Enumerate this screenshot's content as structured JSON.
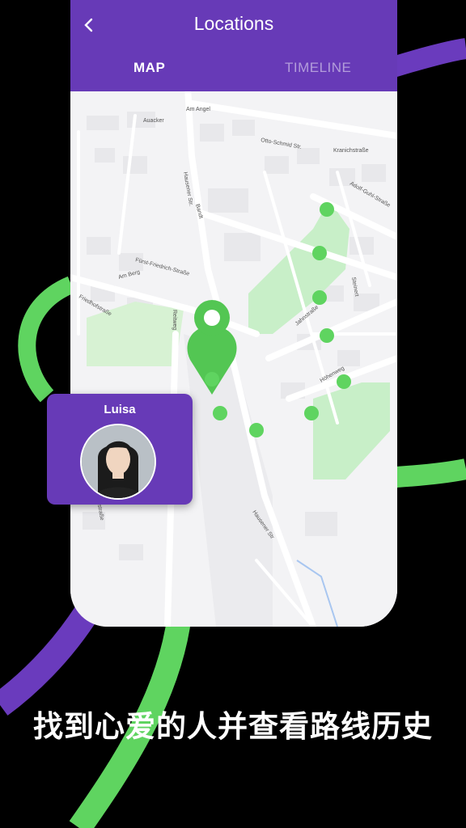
{
  "header": {
    "title": "Locations",
    "back_icon": "chevron-left-icon"
  },
  "tabs": [
    {
      "label": "MAP",
      "active": true
    },
    {
      "label": "TIMELINE",
      "active": false
    }
  ],
  "map": {
    "streets": [
      "Hausener Str.",
      "Am Angel",
      "Auacker",
      "Otto-Schmid Str.",
      "Kranichstraße",
      "Adolf-Guhl-Straße",
      "Bandt",
      "Am Berg",
      "Fürst-Friedrich-Straße",
      "Friedhofstraße",
      "Reitweg",
      "Jahnstraße",
      "Höhenweg",
      "Steinert",
      "Hausener Str",
      "Nellenburgstraße"
    ],
    "pin_icon": "location-pin-icon",
    "track_point_count": 10
  },
  "person": {
    "name": "Luisa",
    "avatar_icon": "avatar"
  },
  "slogan": "找到心爱的人并查看路线历史",
  "colors": {
    "header": "#673ab7",
    "accent_green": "#5fd460",
    "pin_green": "#53c653",
    "background": "#000000"
  }
}
